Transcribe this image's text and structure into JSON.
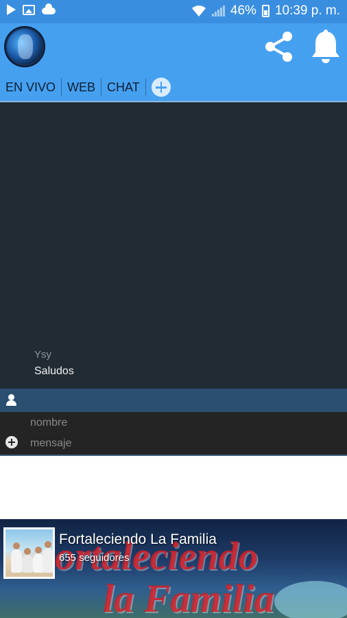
{
  "status_bar": {
    "battery": "46%",
    "time": "10:39 p. m.",
    "left_icons": [
      "play-icon",
      "image-icon",
      "cloud-icon"
    ],
    "right_icons": [
      "wifi-icon",
      "signal-icon",
      "battery-icon"
    ]
  },
  "app_bar": {
    "background": "#46a0f0",
    "logo": "channel-logo",
    "actions": [
      "share-icon",
      "bell-icon"
    ]
  },
  "tabs": [
    {
      "label": "EN VIVO",
      "active": false
    },
    {
      "label": "WEB",
      "active": true
    },
    {
      "label": "CHAT",
      "active": false
    }
  ],
  "tab_indicator_color": "#e8256b",
  "chat": {
    "messages": [
      {
        "author": "Ysy",
        "text": "Saludos"
      }
    ],
    "name_placeholder": "nombre",
    "message_placeholder": "mensaje"
  },
  "facebook_card": {
    "page_name": "Fortaleciendo La Familia",
    "followers": "655 seguidores",
    "cover_line_1": "ortaleciendo",
    "cover_line_2": "la Familia"
  }
}
